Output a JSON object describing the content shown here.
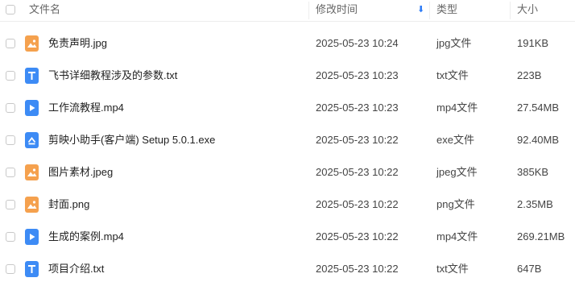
{
  "header": {
    "name": "文件名",
    "modified": "修改时间",
    "type": "类型",
    "size": "大小"
  },
  "colors": {
    "image_icon": "#f5a14e",
    "text_icon": "#3d8bf5",
    "video_icon": "#3d8bf5",
    "exe_icon": "#3d8bf5",
    "sort_arrow": "#2e7cf6"
  },
  "files": [
    {
      "name": "免责声明.jpg",
      "modified": "2025-05-23 10:24",
      "type": "jpg文件",
      "size": "191KB",
      "icon": "image-icon"
    },
    {
      "name": "飞书详细教程涉及的参数.txt",
      "modified": "2025-05-23 10:23",
      "type": "txt文件",
      "size": "223B",
      "icon": "text-icon"
    },
    {
      "name": "工作流教程.mp4",
      "modified": "2025-05-23 10:23",
      "type": "mp4文件",
      "size": "27.54MB",
      "icon": "video-icon"
    },
    {
      "name": "剪映小助手(客户端) Setup 5.0.1.exe",
      "modified": "2025-05-23 10:22",
      "type": "exe文件",
      "size": "92.40MB",
      "icon": "exe-icon"
    },
    {
      "name": "图片素材.jpeg",
      "modified": "2025-05-23 10:22",
      "type": "jpeg文件",
      "size": "385KB",
      "icon": "image-icon"
    },
    {
      "name": "封面.png",
      "modified": "2025-05-23 10:22",
      "type": "png文件",
      "size": "2.35MB",
      "icon": "image-icon"
    },
    {
      "name": "生成的案例.mp4",
      "modified": "2025-05-23 10:22",
      "type": "mp4文件",
      "size": "269.21MB",
      "icon": "video-icon"
    },
    {
      "name": "项目介绍.txt",
      "modified": "2025-05-23 10:22",
      "type": "txt文件",
      "size": "647B",
      "icon": "text-icon"
    }
  ]
}
